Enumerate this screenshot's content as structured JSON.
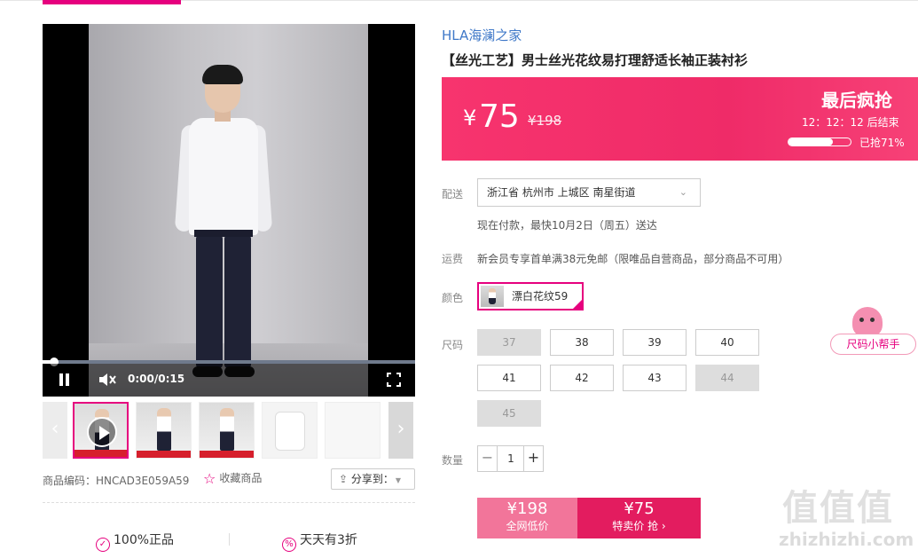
{
  "video": {
    "time": "0:00/0:15",
    "progress": 0.02
  },
  "product": {
    "code_label": "商品编码：HNCAD3E059A59",
    "favorite": "收藏商品",
    "share": "分享到：",
    "brand": "HLA海澜之家",
    "title": "【丝光工艺】男士丝光花纹易打理舒适长袖正装衬衫"
  },
  "price": {
    "yen": "¥",
    "current": "75",
    "original": "¥198",
    "banner": "最后疯抢",
    "countdown": "12：12：12  后结束",
    "sold_label": "已抢71%",
    "sold_fraction": 0.71
  },
  "delivery": {
    "label": "配送",
    "address": "浙江省 杭州市 上城区 南星街道",
    "eta": "现在付款，最快10月2日（周五）送达"
  },
  "shipping": {
    "label": "运费",
    "text": "新会员专享首单满38元免邮（限唯品自营商品，部分商品不可用）"
  },
  "color": {
    "label": "颜色",
    "selected": "漂白花纹59"
  },
  "sizes": {
    "label": "尺码",
    "items": [
      {
        "label": "37",
        "available": false
      },
      {
        "label": "38",
        "available": true
      },
      {
        "label": "39",
        "available": true
      },
      {
        "label": "40",
        "available": true
      },
      {
        "label": "41",
        "available": true
      },
      {
        "label": "42",
        "available": true
      },
      {
        "label": "43",
        "available": true
      },
      {
        "label": "44",
        "available": false
      },
      {
        "label": "45",
        "available": false
      }
    ],
    "helper": "尺码小帮手"
  },
  "quantity": {
    "label": "数量",
    "minus": "−",
    "value": "1",
    "plus": "+"
  },
  "buy": {
    "market_price": "¥198",
    "market_label": "全网低价",
    "sale_price": "¥75",
    "sale_label": "特卖价 抢 ›"
  },
  "guarantees": {
    "g1": "100%正品",
    "g2": "天天有3折"
  },
  "watermark": {
    "big": "值值值",
    "small": "zhizhizhi.com"
  },
  "icons": [
    "pause-icon",
    "mute-icon",
    "fullscreen-icon",
    "play-icon",
    "chevron-left-icon",
    "chevron-right-icon",
    "star-icon",
    "share-icon",
    "shield-icon",
    "discount-icon",
    "chevron-down-icon"
  ],
  "colors": {
    "accent": "#e6007e",
    "price_banner": "#ef2b68",
    "brand_link": "#3f78c8"
  }
}
